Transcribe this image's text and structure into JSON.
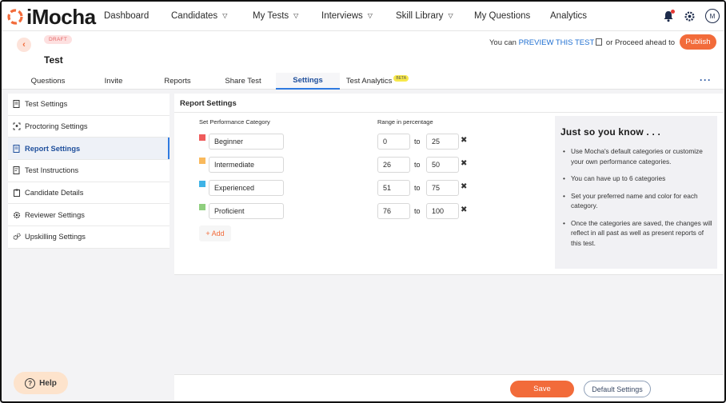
{
  "nav": {
    "logo_text": "iMocha",
    "items": [
      {
        "label": "Dashboard",
        "has_caret": false
      },
      {
        "label": "Candidates",
        "has_caret": true
      },
      {
        "label": "My Tests",
        "has_caret": true
      },
      {
        "label": "Interviews",
        "has_caret": true
      },
      {
        "label": "Skill Library",
        "has_caret": true
      },
      {
        "label": "My Questions",
        "has_caret": false
      },
      {
        "label": "Analytics",
        "has_caret": false
      }
    ],
    "caret_glyph": "▽",
    "avatar_initial": "M"
  },
  "header": {
    "status_badge": "DRAFT",
    "title": "Test",
    "preview_prefix": "You can",
    "preview_link": "PREVIEW THIS TEST",
    "preview_suffix": "or Proceed ahead to",
    "publish_label": "Publish"
  },
  "tabs": [
    {
      "label": "Questions",
      "active": false
    },
    {
      "label": "Invite",
      "active": false
    },
    {
      "label": "Reports",
      "active": false
    },
    {
      "label": "Share Test",
      "active": false
    },
    {
      "label": "Settings",
      "active": true
    },
    {
      "label": "Test Analytics",
      "active": false,
      "badge": "BETA"
    }
  ],
  "sidebar": {
    "items": [
      {
        "label": "Test Settings",
        "icon": "settings-doc-icon",
        "active": false
      },
      {
        "label": "Proctoring Settings",
        "icon": "proctor-icon",
        "active": false
      },
      {
        "label": "Report Settings",
        "icon": "report-icon",
        "active": true
      },
      {
        "label": "Test Instructions",
        "icon": "instructions-icon",
        "active": false
      },
      {
        "label": "Candidate Details",
        "icon": "clipboard-icon",
        "active": false
      },
      {
        "label": "Reviewer Settings",
        "icon": "gear-icon",
        "active": false
      },
      {
        "label": "Upskilling Settings",
        "icon": "gears-icon",
        "active": false
      }
    ]
  },
  "report_settings": {
    "title": "Report Settings",
    "col_category": "Set Performance Category",
    "col_range": "Range in percentage",
    "to_label": "to",
    "categories": [
      {
        "name": "Beginner",
        "color": "#ef5b5b",
        "from": "0",
        "to": "25"
      },
      {
        "name": "Intermediate",
        "color": "#f9b95c",
        "from": "26",
        "to": "50"
      },
      {
        "name": "Experienced",
        "color": "#3fb3e6",
        "from": "51",
        "to": "75"
      },
      {
        "name": "Proficient",
        "color": "#8fcf7e",
        "from": "76",
        "to": "100"
      }
    ],
    "add_label": "+ Add"
  },
  "info": {
    "title": "Just so you know . . .",
    "bullets": [
      "Use Mocha's default categories or customize your own performance categories.",
      "You can have up to 6 categories",
      "Set your preferred name and color for each category.",
      "Once the categories are saved, the changes will reflect in all past as well as present reports of this test."
    ]
  },
  "footer": {
    "save_label": "Save",
    "default_label": "Default Settings"
  },
  "help_label": "Help",
  "colors": {
    "accent": "#f26b3a",
    "primary_blue": "#2f7ae0"
  }
}
